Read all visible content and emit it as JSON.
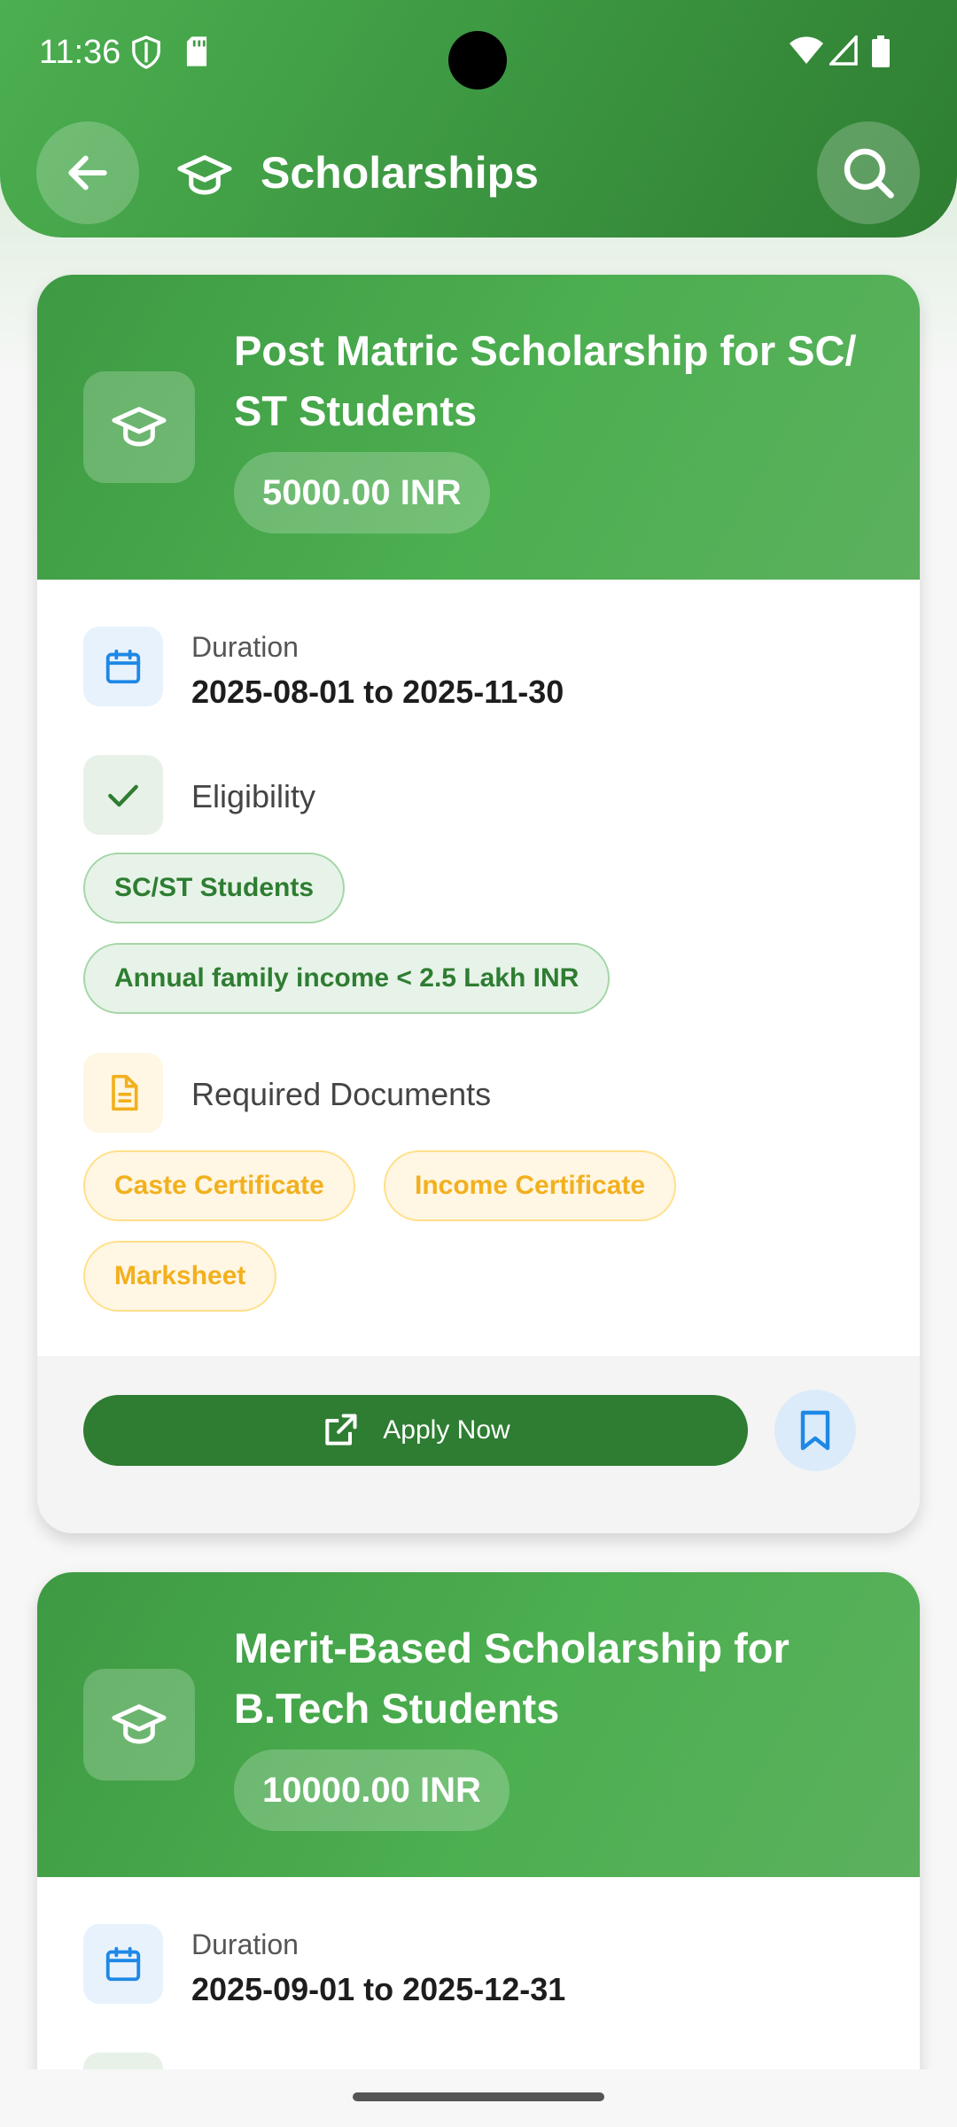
{
  "status_bar": {
    "time": "11:36",
    "icons": [
      "shield-icon",
      "sd-card-icon",
      "wifi-icon",
      "signal-icon",
      "battery-icon"
    ]
  },
  "app_bar": {
    "title": "Scholarships",
    "back_icon": "arrow-left-icon",
    "title_icon": "graduation-cap-icon",
    "search_icon": "search-icon"
  },
  "colors": {
    "primary_green": "#2e7d32",
    "header_green": "#4caf50",
    "info_blue": "#1e88e5",
    "doc_orange": "#f2b01e"
  },
  "scholarships": [
    {
      "title": "Post Matric Scholarship for SC/ ST Students",
      "amount": "5000.00 INR",
      "duration_label": "Duration",
      "duration": "2025-08-01 to 2025-11-30",
      "eligibility_label": "Eligibility",
      "eligibility": [
        "SC/ST Students",
        "Annual family income < 2.5 Lakh INR"
      ],
      "documents_label": "Required Documents",
      "documents": [
        "Caste Certificate",
        "Income Certificate",
        "Marksheet"
      ],
      "apply_label": "Apply Now"
    },
    {
      "title": "Merit-Based Scholarship for B.Tech Students",
      "amount": "10000.00 INR",
      "duration_label": "Duration",
      "duration": "2025-09-01 to 2025-12-31"
    }
  ]
}
